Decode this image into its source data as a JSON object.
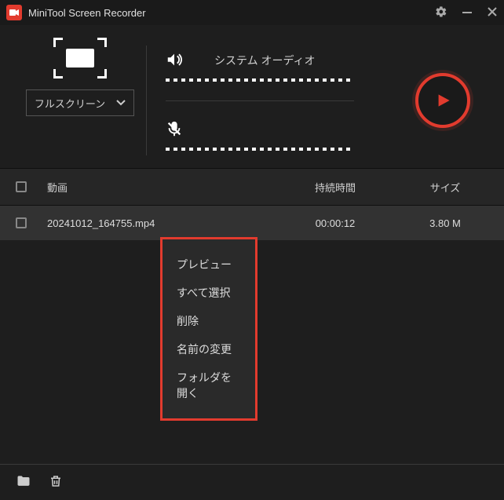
{
  "titlebar": {
    "app_name": "MiniTool Screen Recorder"
  },
  "capture": {
    "mode_label": "フルスクリーン"
  },
  "audio": {
    "system_label": "システム オーディオ"
  },
  "table": {
    "headers": {
      "video": "動画",
      "duration": "持続時間",
      "size": "サイズ"
    },
    "rows": [
      {
        "name": "20241012_164755.mp4",
        "duration": "00:00:12",
        "size": "3.80 M"
      }
    ]
  },
  "context_menu": {
    "items": [
      "プレビュー",
      "すべて選択",
      "削除",
      "名前の変更",
      "フォルダを開く"
    ]
  }
}
